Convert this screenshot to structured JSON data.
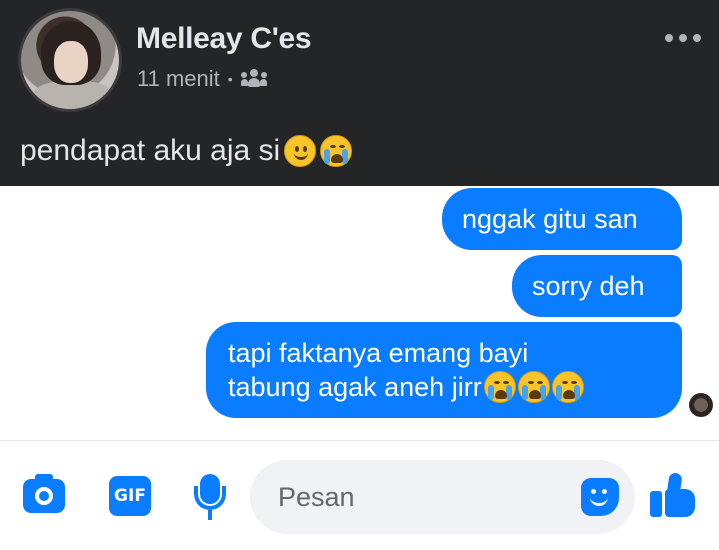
{
  "post": {
    "author_name": "Melleay C'es",
    "time": "11 menit",
    "separator": "•",
    "audience_icon": "friends-icon",
    "text": "pendapat aku aja si",
    "emojis": [
      "slightly-smiling-face",
      "loudly-crying-face"
    ]
  },
  "messages": [
    {
      "text": "nggak gitu san"
    },
    {
      "text": "sorry deh"
    },
    {
      "line1": "tapi faktanya emang bayi",
      "line2": "tabung agak aneh jirr",
      "emojis": [
        "loudly-crying-face",
        "loudly-crying-face",
        "loudly-crying-face"
      ]
    }
  ],
  "composer": {
    "placeholder": "Pesan",
    "gif_label": "GIF",
    "icons": [
      "camera-icon",
      "gif-icon",
      "microphone-icon",
      "sticker-icon",
      "like-icon"
    ]
  },
  "colors": {
    "accent": "#0a7cff",
    "post_background": "#242526",
    "post_text": "#e4e6eb",
    "muted_text": "#b0b3b8"
  }
}
